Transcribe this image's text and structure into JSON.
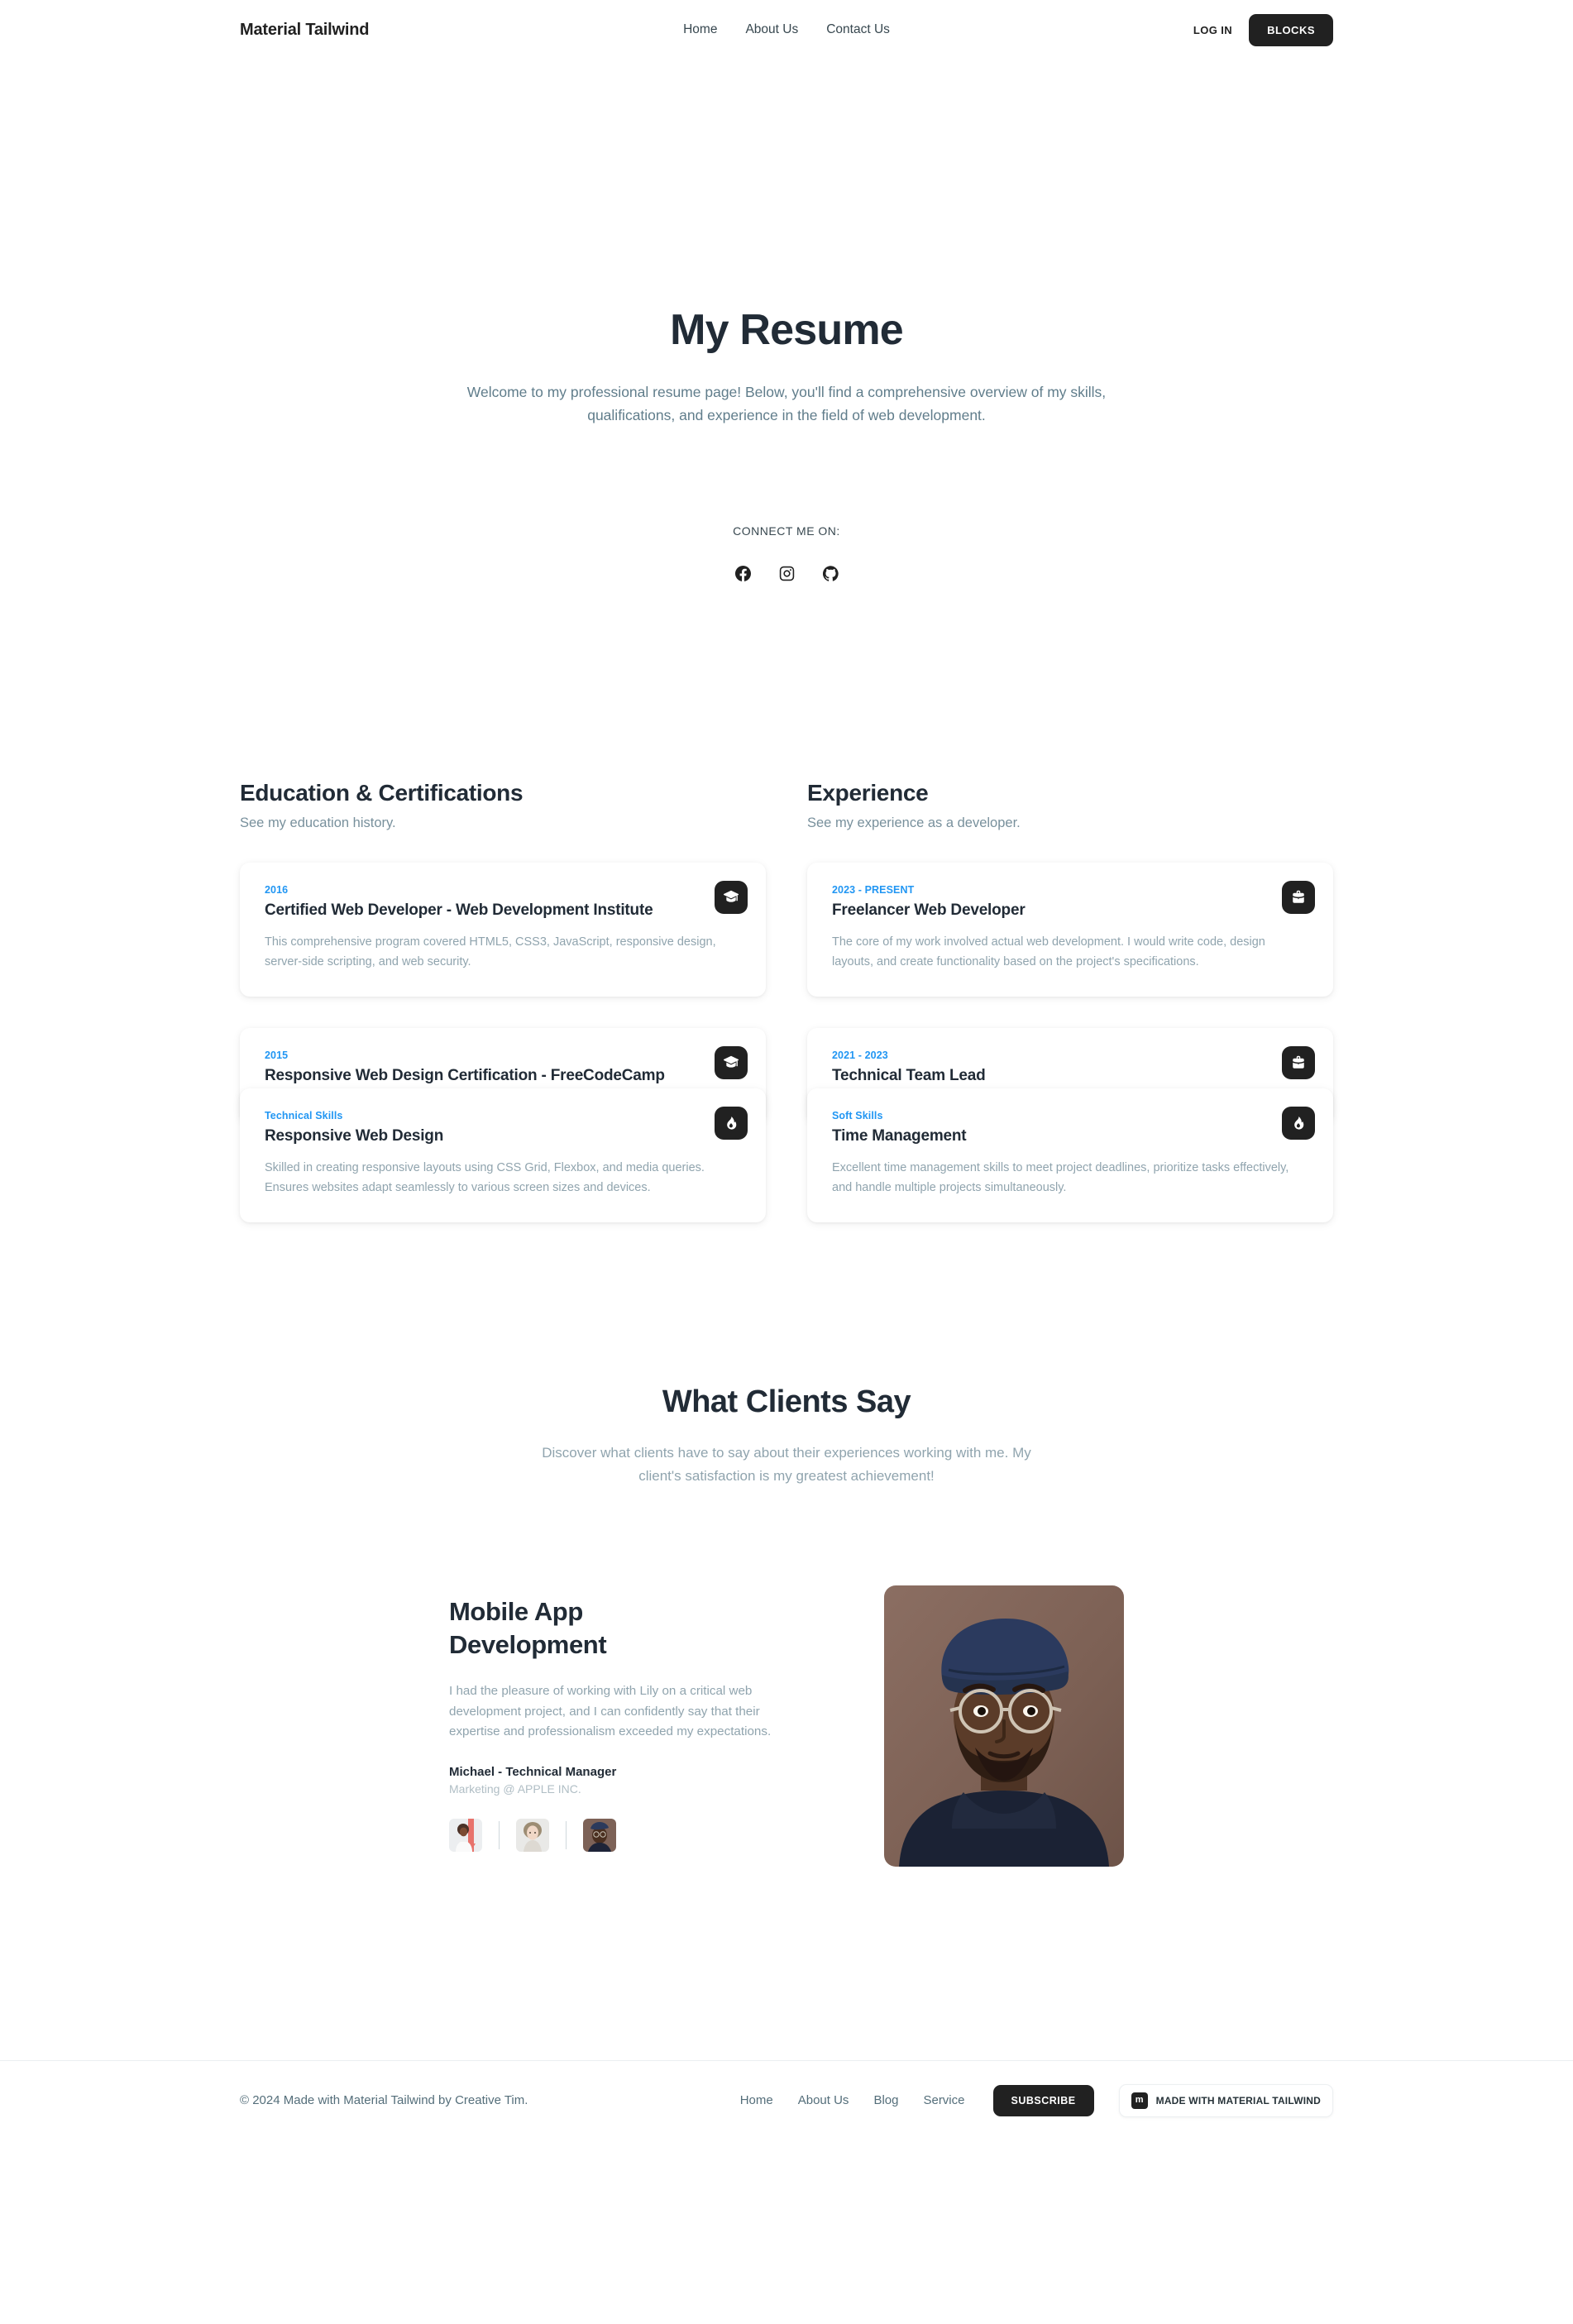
{
  "navbar": {
    "brand": "Material Tailwind",
    "links": [
      {
        "label": "Home"
      },
      {
        "label": "About Us"
      },
      {
        "label": "Contact Us"
      }
    ],
    "login_label": "LOG IN",
    "blocks_label": "BLOCKS"
  },
  "hero": {
    "title": "My Resume",
    "subtitle": "Welcome to my professional resume page! Below, you'll find a comprehensive overview of my skills, qualifications, and experience in the field of web development.",
    "connect_label": "CONNECT ME ON:",
    "socials": [
      {
        "name": "facebook-icon"
      },
      {
        "name": "instagram-icon"
      },
      {
        "name": "github-icon"
      }
    ]
  },
  "resume": {
    "education": {
      "heading": "Education & Certifications",
      "subheading": "See my education history.",
      "cards": [
        {
          "tag": "2016",
          "title": "Certified Web Developer - Web Development Institute",
          "desc": "This comprehensive program covered HTML5, CSS3, JavaScript, responsive design, server-side scripting, and web security.",
          "icon": "graduation-cap-icon"
        },
        {
          "tag": "2015",
          "title": "Responsive Web Design Certification - FreeCodeCamp",
          "desc": "",
          "icon": "graduation-cap-icon"
        },
        {
          "tag": "Technical Skills",
          "title": "Responsive Web Design",
          "desc": "Skilled in creating responsive layouts using CSS Grid, Flexbox, and media queries. Ensures websites adapt seamlessly to various screen sizes and devices.",
          "icon": "fire-icon"
        }
      ]
    },
    "experience": {
      "heading": "Experience",
      "subheading": "See my experience as a developer.",
      "cards": [
        {
          "tag": "2023 - PRESENT",
          "title": "Freelancer Web Developer",
          "desc": "The core of my work involved actual web development. I would write code, design layouts, and create functionality based on the project's specifications.",
          "icon": "briefcase-icon"
        },
        {
          "tag": "2021 - 2023",
          "title": "Technical Team Lead",
          "desc": "",
          "icon": "briefcase-icon"
        },
        {
          "tag": "Soft Skills",
          "title": "Time Management",
          "desc": "Excellent time management skills to meet project deadlines, prioritize tasks effectively, and handle multiple projects simultaneously.",
          "icon": "fire-icon"
        }
      ]
    }
  },
  "clients": {
    "heading": "What Clients Say",
    "subheading": "Discover what clients have to say about their experiences working with me. My client's satisfaction is my greatest achievement!"
  },
  "testimonial": {
    "title": "Mobile App Development",
    "quote": "I had the pleasure of working with Lily on a critical web development project, and I can confidently say that their expertise and professionalism exceeded my expectations.",
    "name": "Michael - Technical Manager",
    "role": "Marketing @ APPLE INC.",
    "avatars": [
      {
        "name": "avatar-thumb-1"
      },
      {
        "name": "avatar-thumb-2"
      },
      {
        "name": "avatar-thumb-3"
      }
    ],
    "photo_name": "testimonial-portrait"
  },
  "footer": {
    "copyright": "© 2024 Made with Material Tailwind by Creative Tim.",
    "links": [
      {
        "label": "Home"
      },
      {
        "label": "About Us"
      },
      {
        "label": "Blog"
      },
      {
        "label": "Service"
      }
    ],
    "subscribe_label": "SUBSCRIBE",
    "badge_mark": "m",
    "badge_text": "MADE WITH MATERIAL TAILWIND"
  },
  "colors": {
    "accent_blue": "#2196f3",
    "dark": "#212121",
    "heading": "#212b36",
    "muted": "#90a4ae"
  }
}
